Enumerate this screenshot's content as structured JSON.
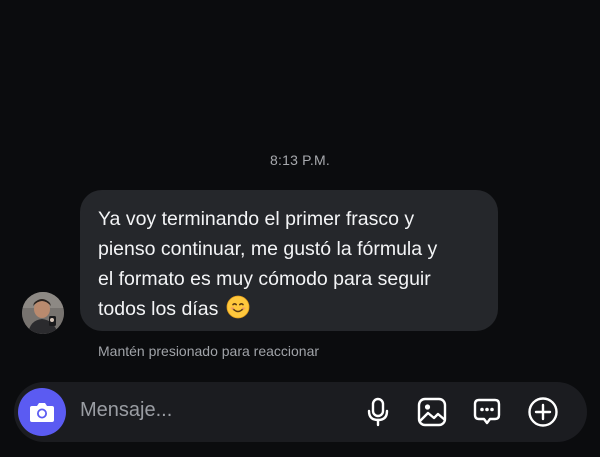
{
  "conversation": {
    "timestamp": "8:13 P.M.",
    "message": {
      "lines": [
        "Ya voy terminando el primer frasco y",
        "pienso continuar, me gustó la fórmula y",
        "el formato es muy cómodo para seguir",
        "todos los días"
      ],
      "emoji": "smiling-face-emoji"
    },
    "reaction_hint": "Mantén presionado para reaccionar"
  },
  "composer": {
    "placeholder": "Mensaje...",
    "icons": [
      "camera-icon",
      "microphone-icon",
      "image-icon",
      "message-dots-icon",
      "plus-circle-icon"
    ]
  },
  "colors": {
    "background": "#0b0c0e",
    "bubble": "#25272b",
    "accent": "#5b5bf2"
  }
}
